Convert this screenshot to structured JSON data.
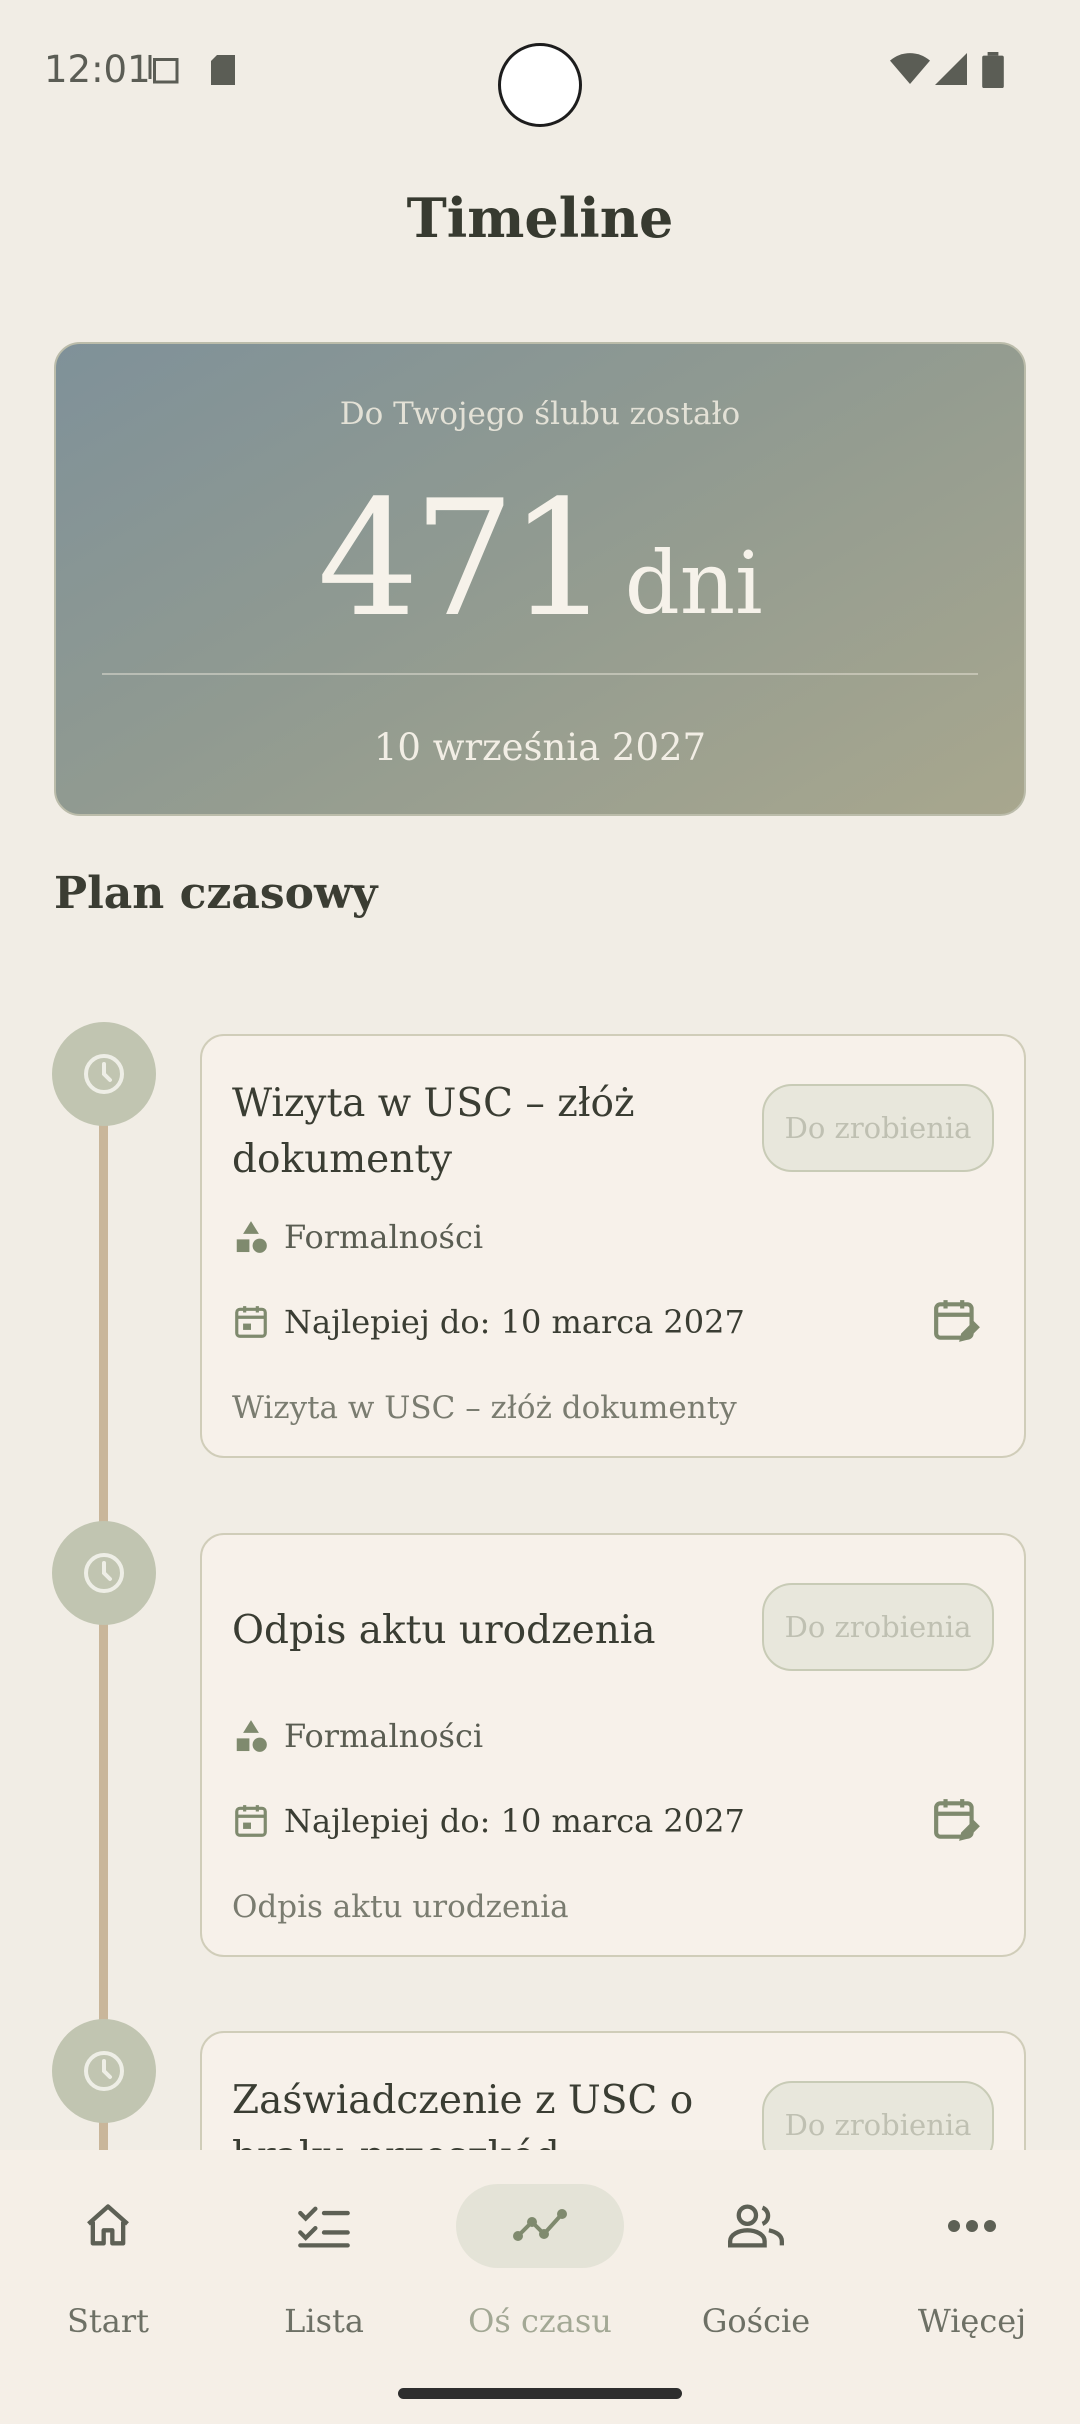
{
  "status_bar": {
    "time": "12:01"
  },
  "header": {
    "title": "Timeline"
  },
  "countdown": {
    "caption": "Do Twojego ślubu zostało",
    "value": "471",
    "unit": "dni",
    "date": "10 września 2027"
  },
  "section": {
    "title": "Plan czasowy"
  },
  "tasks": [
    {
      "title": "Wizyta w USC – złóż dokumenty",
      "status": "Do zrobienia",
      "category": "Formalności",
      "deadline": "Najlepiej do: 10 marca 2027",
      "description": "Wizyta w USC – złóż dokumenty"
    },
    {
      "title": "Odpis aktu urodzenia",
      "status": "Do zrobienia",
      "category": "Formalności",
      "deadline": "Najlepiej do: 10 marca 2027",
      "description": "Odpis aktu urodzenia"
    },
    {
      "title": "Zaświadczenie z USC o braku przeszkód",
      "status": "Do zrobienia"
    }
  ],
  "nav": {
    "items": [
      {
        "label": "Start",
        "icon": "home-icon"
      },
      {
        "label": "Lista",
        "icon": "checklist-icon"
      },
      {
        "label": "Oś czasu",
        "icon": "timeline-icon",
        "active": true
      },
      {
        "label": "Goście",
        "icon": "guests-icon"
      },
      {
        "label": "Więcej",
        "icon": "more-icon"
      }
    ]
  },
  "colors": {
    "background": "#f1ede5",
    "card": "#f7f1ea",
    "accent": "#7f8a6e",
    "timeline": "#c9b69a"
  }
}
